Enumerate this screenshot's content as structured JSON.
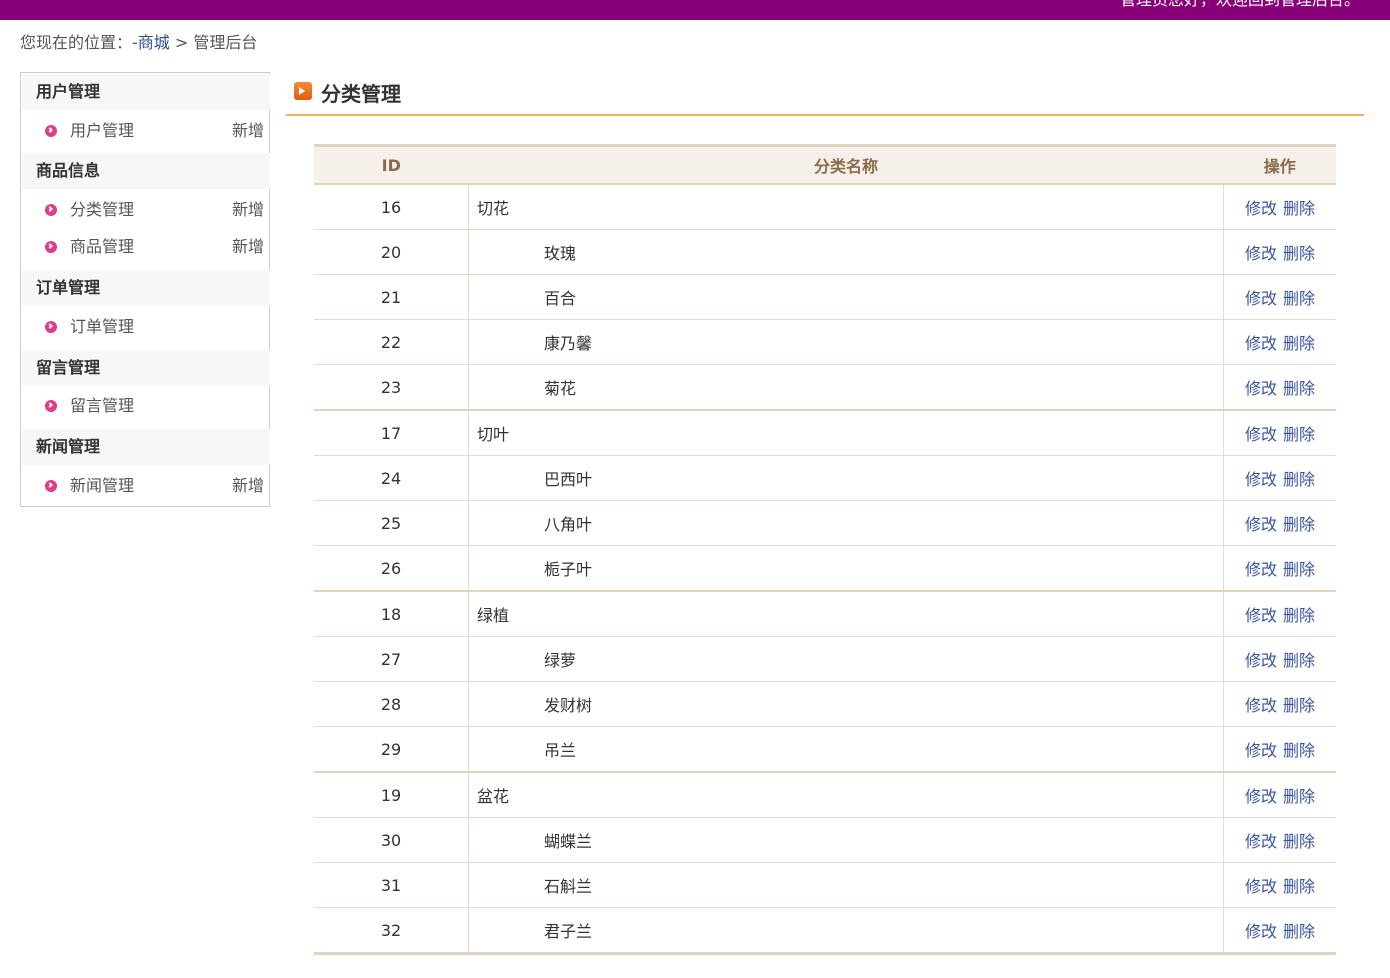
{
  "header": {
    "welcome": "管理员您好，欢迎回到管理后台。",
    "color": "#870078"
  },
  "breadcrumb": {
    "prefix": "您现在的位置：",
    "dash": "-",
    "home": "商城",
    "sep": " > ",
    "current": "管理后台"
  },
  "sidebar": {
    "sections": [
      {
        "title": "用户管理",
        "items": [
          {
            "label": "用户管理",
            "add": "新增"
          }
        ]
      },
      {
        "title": "商品信息",
        "items": [
          {
            "label": "分类管理",
            "add": "新增"
          },
          {
            "label": "商品管理",
            "add": "新增"
          }
        ]
      },
      {
        "title": "订单管理",
        "items": [
          {
            "label": "订单管理",
            "add": ""
          }
        ]
      },
      {
        "title": "留言管理",
        "items": [
          {
            "label": "留言管理",
            "add": ""
          }
        ]
      },
      {
        "title": "新闻管理",
        "items": [
          {
            "label": "新闻管理",
            "add": "新增"
          }
        ]
      }
    ],
    "bullet_icon": "chevron-right-circle-icon",
    "bullet_color": "#e03c8a"
  },
  "main": {
    "title": "分类管理",
    "title_icon": "arrow-right-box-icon",
    "table": {
      "headers": {
        "id": "ID",
        "name": "分类名称",
        "action": "操作"
      },
      "edit_label": "修改",
      "delete_label": "删除",
      "rows": [
        {
          "id": "16",
          "name": "切花",
          "child": false
        },
        {
          "id": "20",
          "name": "玫瑰",
          "child": true
        },
        {
          "id": "21",
          "name": "百合",
          "child": true
        },
        {
          "id": "22",
          "name": "康乃馨",
          "child": true
        },
        {
          "id": "23",
          "name": "菊花",
          "child": true
        },
        {
          "id": "17",
          "name": "切叶",
          "child": false
        },
        {
          "id": "24",
          "name": "巴西叶",
          "child": true
        },
        {
          "id": "25",
          "name": "八角叶",
          "child": true
        },
        {
          "id": "26",
          "name": "栀子叶",
          "child": true
        },
        {
          "id": "18",
          "name": "绿植",
          "child": false
        },
        {
          "id": "27",
          "name": "绿萝",
          "child": true
        },
        {
          "id": "28",
          "name": "发财树",
          "child": true
        },
        {
          "id": "29",
          "name": "吊兰",
          "child": true
        },
        {
          "id": "19",
          "name": "盆花",
          "child": false
        },
        {
          "id": "30",
          "name": "蝴蝶兰",
          "child": true
        },
        {
          "id": "31",
          "name": "石斛兰",
          "child": true
        },
        {
          "id": "32",
          "name": "君子兰",
          "child": true
        }
      ]
    }
  }
}
